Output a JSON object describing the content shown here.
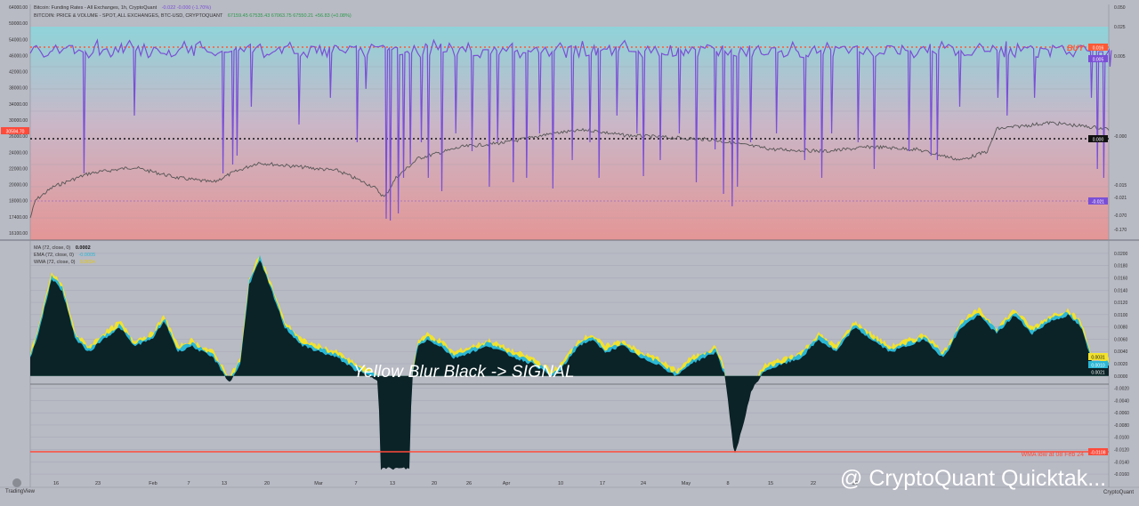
{
  "legend": {
    "funding_title": "Bitcoin: Funding Rates - All Exchanges, 1h, CryptoQuant",
    "funding_values": "-0.022  -0.000 (-1.70%)",
    "price_title": "BITCOIN: PRICE & VOLUME - SPOT, ALL EXCHANGES, BTC-USD, CRYPTOQUANT",
    "price_values": "67159.45  67535.43  67063.75  67550.21  +56.83 (+0.08%)",
    "ma_label": "MA (72, close, 0)",
    "ma_value": "0.0002",
    "ema_label": "EMA (72, close, 0)",
    "ema_value": "-0.0005",
    "wma_label": "WMA (72, close, 0)",
    "wma_value": "0.0014"
  },
  "colors": {
    "funding_line": "#7a4fd6",
    "price_line": "#555555",
    "area_black": "#0b2226",
    "area_blue": "#2bb7d6",
    "area_yellow": "#f2e22e",
    "buy_line": "#ff5a36",
    "low_line": "#ff4a3a",
    "top_gradient": "#8fd3d9",
    "bottom_gradient": "#e49696"
  },
  "annotations": {
    "signal": "Yellow Blur Black -> SIGNAL",
    "buy_tag": "BUY",
    "low_label": "WMA low at 08 Feb 24",
    "watermark": "@ CryptoQuant Quicktak...",
    "tv_logo": "TradingView",
    "cq_logo": "CryptoQuant"
  },
  "chart_data": [
    {
      "type": "line",
      "y_left_ticks": [
        "64000.00",
        "59000.00",
        "54000.00",
        "46000.00",
        "42000.00",
        "38000.00",
        "34000.00",
        "30000.00",
        "26000.00",
        "24000.00",
        "22000.00",
        "20000.00",
        "18000.00",
        "17400.00",
        "16100.00"
      ],
      "y_right_ticks": [
        "0.050",
        "0.025",
        "0.005",
        "-0.000",
        "-0.015",
        "-0.021",
        "-0.070",
        "-0.170"
      ],
      "price_marker": "30594.70",
      "funding_marker": "0.005",
      "buy_marker": "0.016",
      "zero_marker": "0.000",
      "neg_marker": "-0.021",
      "x_ticks": [
        "16",
        "23",
        "Feb",
        "7",
        "13",
        "20",
        "Mar",
        "7",
        "13",
        "20",
        "26",
        "Apr",
        "10",
        "17",
        "24",
        "May",
        "8",
        "15",
        "22",
        "29"
      ]
    },
    {
      "type": "area",
      "y_ticks": [
        "0.0200",
        "0.0180",
        "0.0160",
        "0.0140",
        "0.0120",
        "0.0100",
        "0.0080",
        "0.0060",
        "0.0040",
        "0.0020",
        "0.0000",
        "-0.0020",
        "-0.0040",
        "-0.0060",
        "-0.0080",
        "-0.0100",
        "-0.0120",
        "-0.0140",
        "-0.0160"
      ],
      "right_markers": [
        "0.0031",
        "0.0010",
        "0.0021"
      ],
      "low_marker": "-0.0108",
      "ylim": [
        -0.017,
        0.021
      ],
      "series_names": [
        "MA",
        "EMA",
        "WMA"
      ]
    }
  ]
}
